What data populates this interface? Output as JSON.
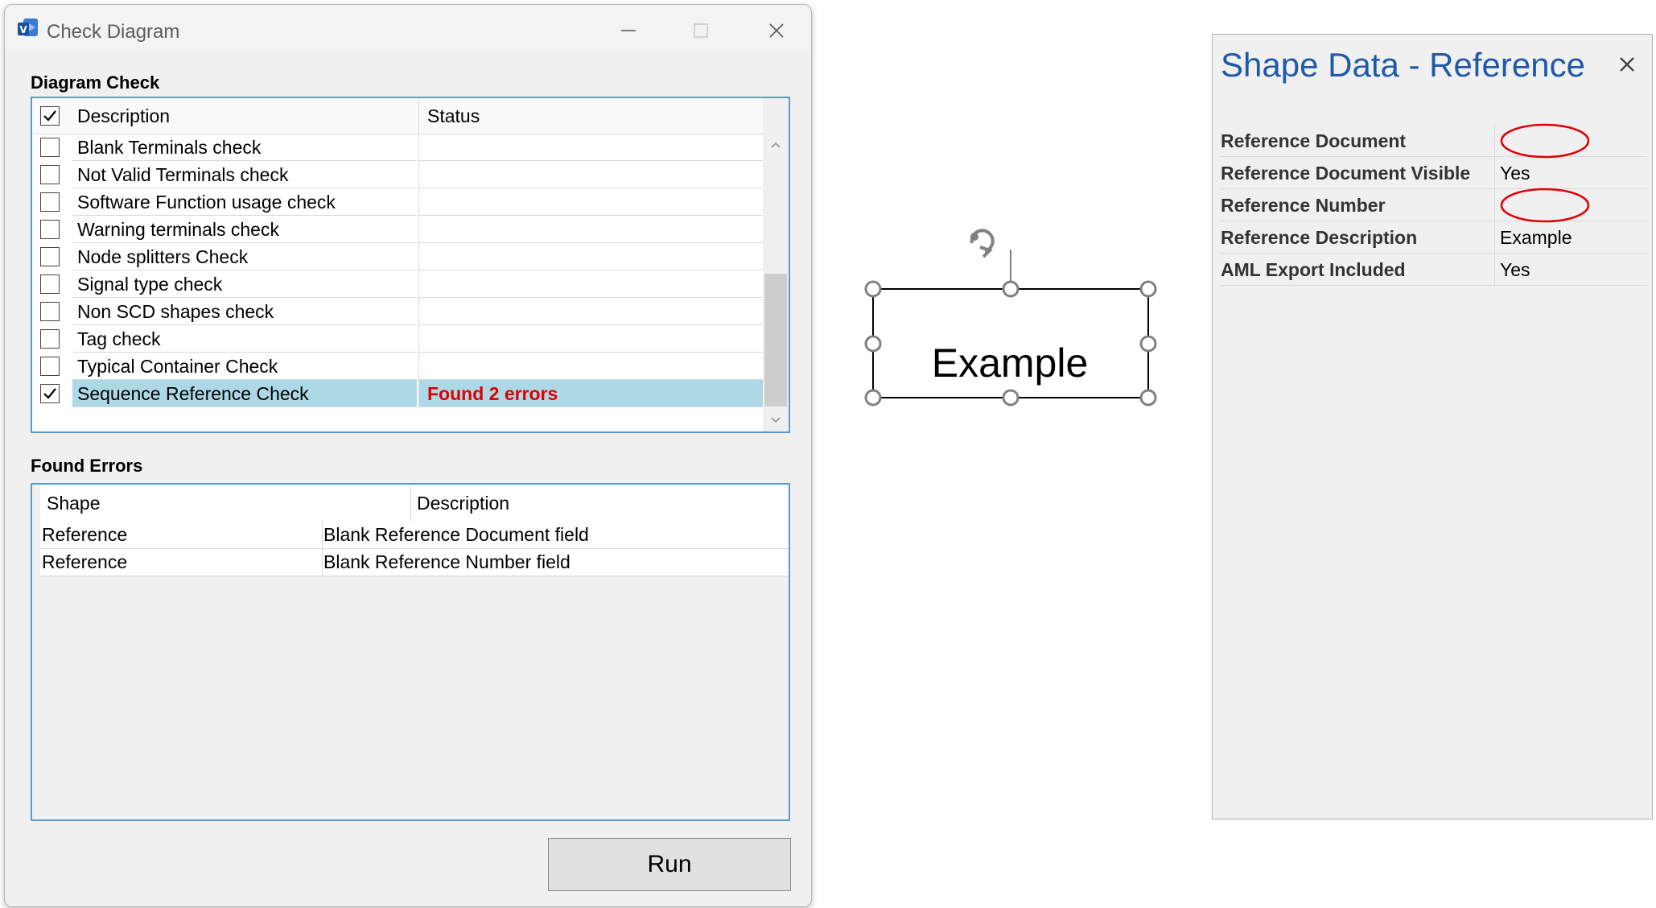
{
  "window": {
    "title": "Check Diagram"
  },
  "diagram_check": {
    "section_label": "Diagram Check",
    "columns": {
      "description": "Description",
      "status": "Status"
    },
    "header_checked": true,
    "rows": [
      {
        "label": "Blank Terminals check",
        "status": "",
        "checked": false,
        "selected": false
      },
      {
        "label": "Not Valid Terminals check",
        "status": "",
        "checked": false,
        "selected": false
      },
      {
        "label": "Software Function usage check",
        "status": "",
        "checked": false,
        "selected": false
      },
      {
        "label": "Warning terminals check",
        "status": "",
        "checked": false,
        "selected": false
      },
      {
        "label": "Node splitters Check",
        "status": "",
        "checked": false,
        "selected": false
      },
      {
        "label": "Signal type check",
        "status": "",
        "checked": false,
        "selected": false
      },
      {
        "label": "Non SCD shapes check",
        "status": "",
        "checked": false,
        "selected": false
      },
      {
        "label": "Tag check",
        "status": "",
        "checked": false,
        "selected": false
      },
      {
        "label": "Typical Container Check",
        "status": "",
        "checked": false,
        "selected": false
      },
      {
        "label": "Sequence Reference Check",
        "status": "Found 2 errors",
        "checked": true,
        "selected": true
      }
    ]
  },
  "found_errors": {
    "section_label": "Found Errors",
    "columns": {
      "shape": "Shape",
      "description": "Description"
    },
    "rows": [
      {
        "shape": "Reference",
        "description": "Blank Reference Document field"
      },
      {
        "shape": "Reference",
        "description": "Blank Reference Number field"
      }
    ]
  },
  "run_button": {
    "label": "Run"
  },
  "canvas": {
    "shape_text": "Example"
  },
  "shape_data": {
    "title": "Shape Data - Reference",
    "rows": [
      {
        "key": "Reference Document",
        "value": "",
        "highlight": true
      },
      {
        "key": "Reference Document Visible",
        "value": "Yes",
        "highlight": false
      },
      {
        "key": "Reference Number",
        "value": "",
        "highlight": true
      },
      {
        "key": "Reference Description",
        "value": "Example",
        "highlight": false
      },
      {
        "key": "AML Export Included",
        "value": "Yes",
        "highlight": false
      }
    ]
  },
  "colors": {
    "selection": "#add8e6",
    "error_text": "#e00000",
    "panel_title": "#1e5aa8",
    "list_border": "#5b9bd5",
    "highlight_ellipse": "#e00000"
  }
}
